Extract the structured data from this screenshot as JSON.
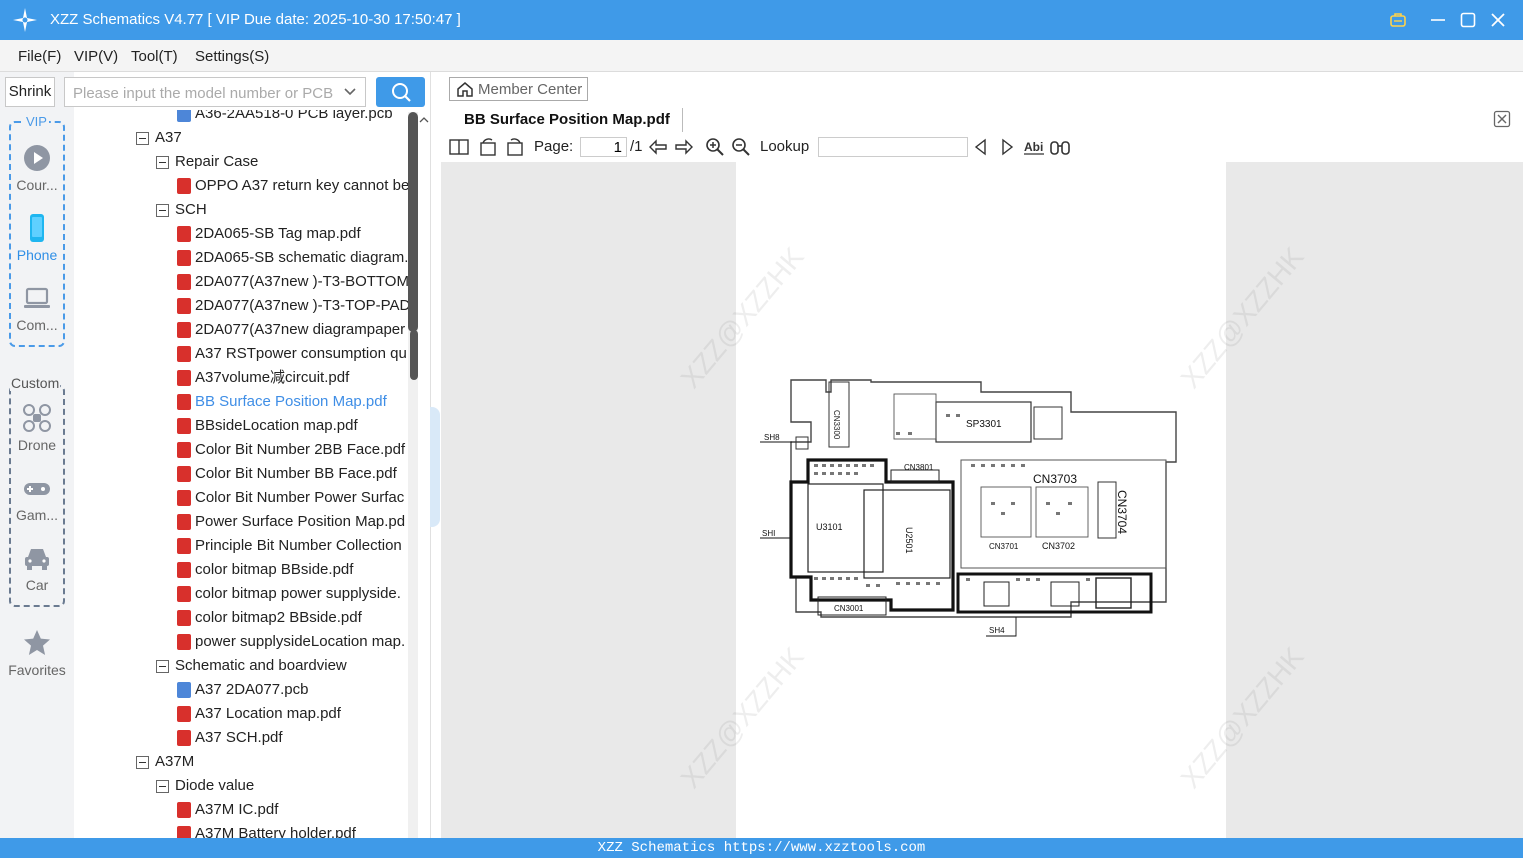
{
  "window": {
    "title": "XZZ Schematics V4.77 [ VIP Due date: 2025-10-30 17:50:47 ]"
  },
  "menu": [
    "File(F)",
    "VIP(V)",
    "Tool(T)",
    "Settings(S)"
  ],
  "left_toolbar": {
    "shrink_label": "Shrink"
  },
  "search": {
    "placeholder": "Please input the model number or PCB"
  },
  "rail": {
    "vip_label": "VIP",
    "custom_label": "Custom",
    "items": [
      {
        "label": "Cour...",
        "icon": "play-circle-icon"
      },
      {
        "label": "Phone",
        "icon": "phone-icon"
      },
      {
        "label": "Com...",
        "icon": "laptop-icon"
      },
      {
        "label": "Drone",
        "icon": "drone-icon"
      },
      {
        "label": "Gam...",
        "icon": "gamepad-icon"
      },
      {
        "label": "Car",
        "icon": "car-icon"
      },
      {
        "label": "Favorites",
        "icon": "star-icon"
      }
    ]
  },
  "tree": [
    {
      "label": "A36-2AA518-0 PCB layer.pcb",
      "type": "pcb"
    },
    {
      "label": "A37",
      "type": "folder"
    },
    {
      "label": "Repair Case",
      "type": "folder"
    },
    {
      "label": "OPPO A37 return key cannot be",
      "type": "pdf"
    },
    {
      "label": "SCH",
      "type": "folder"
    },
    {
      "label": "2DA065-SB Tag map.pdf",
      "type": "pdf"
    },
    {
      "label": "2DA065-SB schematic diagram.",
      "type": "pdf"
    },
    {
      "label": "2DA077(A37new )-T3-BOTTOM",
      "type": "pdf"
    },
    {
      "label": "2DA077(A37new )-T3-TOP-PAD",
      "type": "pdf"
    },
    {
      "label": "2DA077(A37new diagrampaper",
      "type": "pdf"
    },
    {
      "label": "A37 RSTpower consumption qu",
      "type": "pdf"
    },
    {
      "label": "A37volume减circuit.pdf",
      "type": "pdf"
    },
    {
      "label": "BB Surface Position Map.pdf",
      "type": "pdf"
    },
    {
      "label": "BBsideLocation map.pdf",
      "type": "pdf"
    },
    {
      "label": "Color Bit Number 2BB Face.pdf",
      "type": "pdf"
    },
    {
      "label": "Color Bit Number BB Face.pdf",
      "type": "pdf"
    },
    {
      "label": "Color Bit Number Power Surfac",
      "type": "pdf"
    },
    {
      "label": "Power Surface Position Map.pd",
      "type": "pdf"
    },
    {
      "label": "Principle Bit Number Collection",
      "type": "pdf"
    },
    {
      "label": "color bitmap BBside.pdf",
      "type": "pdf"
    },
    {
      "label": "color bitmap power supplyside.",
      "type": "pdf"
    },
    {
      "label": "color bitmap2 BBside.pdf",
      "type": "pdf"
    },
    {
      "label": "power supplysideLocation map.",
      "type": "pdf"
    },
    {
      "label": "Schematic and boardview",
      "type": "folder"
    },
    {
      "label": "A37 2DA077.pcb",
      "type": "pcb"
    },
    {
      "label": "A37 Location map.pdf",
      "type": "pdf"
    },
    {
      "label": "A37 SCH.pdf",
      "type": "pdf"
    },
    {
      "label": "A37M",
      "type": "folder"
    },
    {
      "label": "Diode value",
      "type": "folder"
    },
    {
      "label": "A37M  IC.pdf",
      "type": "pdf"
    },
    {
      "label": "A37M Battery holder.pdf",
      "type": "pdf"
    }
  ],
  "viewer": {
    "member_center": "Member Center",
    "doc_tab": "BB Surface Position Map.pdf",
    "page_label": "Page:",
    "page_value": "1",
    "page_total": "/1",
    "lookup_label": "Lookup",
    "watermark": "XZZ@XZZHK"
  },
  "board_labels": [
    "CN3300",
    "SP3301",
    "SH8",
    "CN3801",
    "CN3703",
    "CN3704",
    "U3101",
    "U2501",
    "SHI",
    "CN3701",
    "CN3702",
    "CN3001",
    "SH4"
  ],
  "status": {
    "text": "XZZ Schematics https://www.xzztools.com"
  },
  "colors": {
    "accent": "#3f9ae8",
    "selected_text": "#3f8ee6",
    "pdf_icon": "#d8302c"
  }
}
